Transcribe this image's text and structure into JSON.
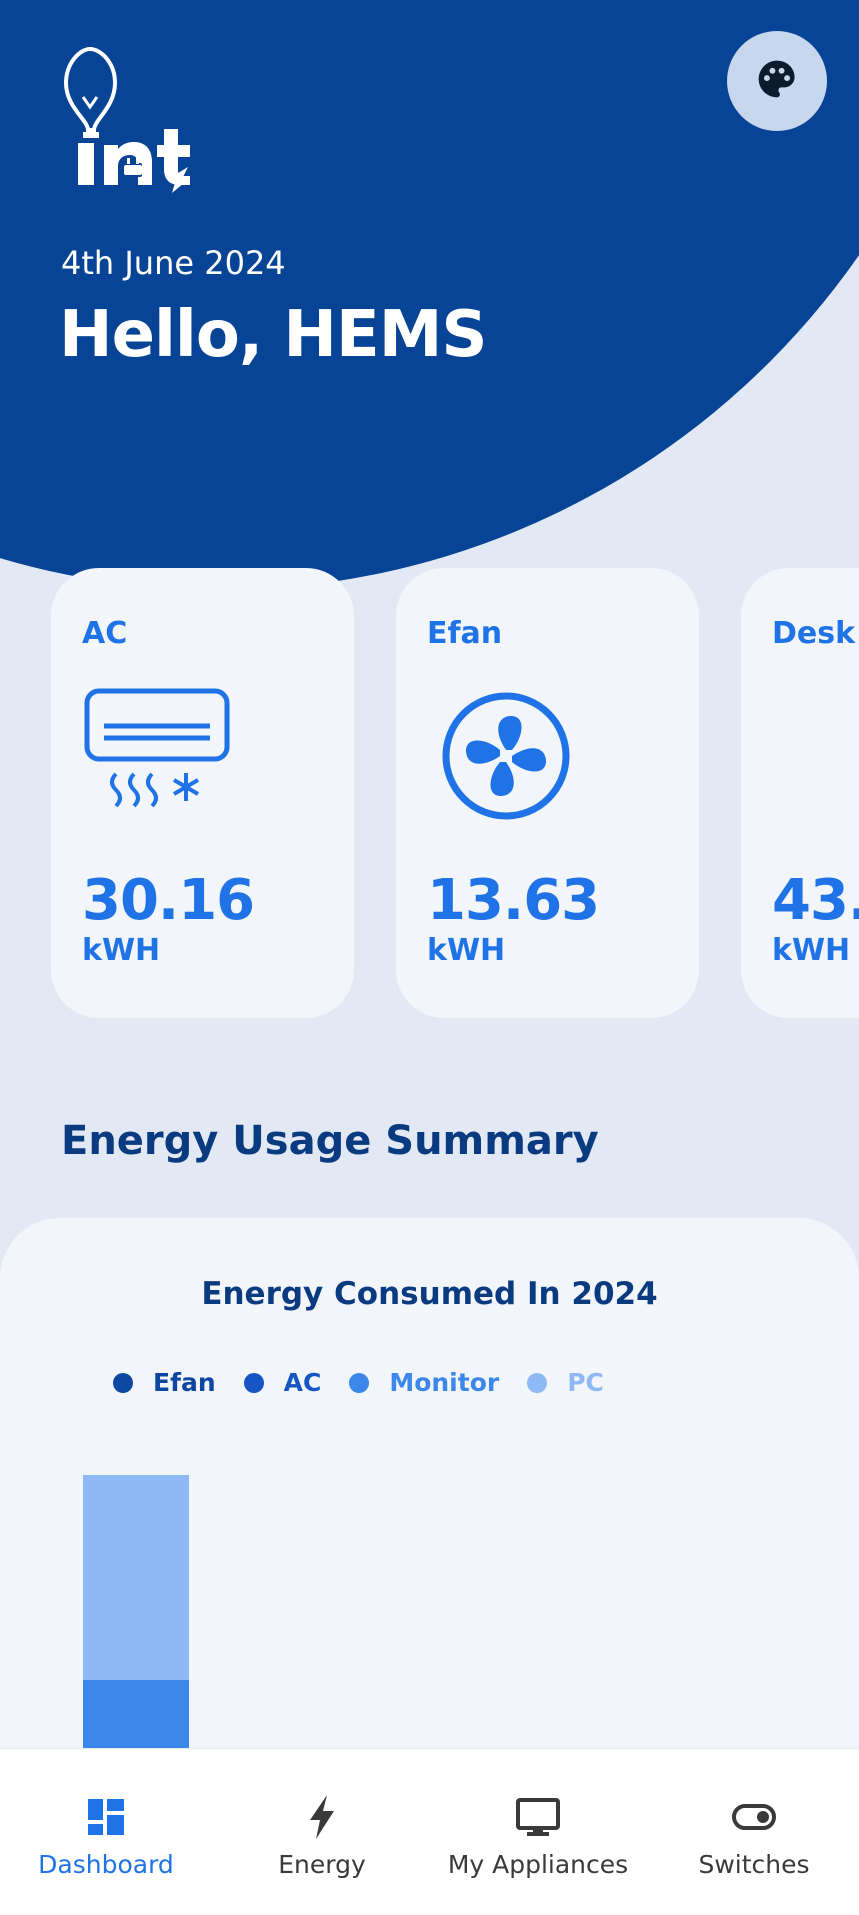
{
  "header": {
    "date": "4th June 2024",
    "greeting": "Hello, HEMS"
  },
  "icons": {
    "logo": "int-bulb-logo",
    "theme": "palette-icon"
  },
  "appliances": [
    {
      "name": "AC",
      "icon": "air-conditioner-icon",
      "value": "30.16",
      "unit": "kWH"
    },
    {
      "name": "Efan",
      "icon": "fan-icon",
      "value": "13.63",
      "unit": "kWH"
    },
    {
      "name": "Desk",
      "icon": "",
      "value": "43.",
      "unit": "kWH"
    }
  ],
  "section_title": "Energy Usage Summary",
  "chart_data": {
    "type": "bar",
    "title": "Energy Consumed In 2024",
    "stacked": true,
    "legend": "top",
    "series": [
      {
        "name": "Efan",
        "color": "#0d47a1",
        "values": [
          0
        ]
      },
      {
        "name": "AC",
        "color": "#1556c4",
        "values": [
          0
        ]
      },
      {
        "name": "Monitor",
        "color": "#3b87ea",
        "values": [
          68
        ]
      },
      {
        "name": "PC",
        "color": "#8fb9f4",
        "values": [
          205
        ]
      }
    ],
    "categories": [
      ""
    ],
    "grid": false
  },
  "nav": {
    "items": [
      {
        "label": "Dashboard",
        "icon": "dashboard-icon",
        "active": true
      },
      {
        "label": "Energy",
        "icon": "lightning-icon",
        "active": false
      },
      {
        "label": "My Appliances",
        "icon": "monitor-icon",
        "active": false
      },
      {
        "label": "Switches",
        "icon": "toggle-icon",
        "active": false
      }
    ]
  },
  "colors": {
    "primary_dark": "#084496",
    "accent": "#1f73e6",
    "background": "#e3e9f4",
    "card": "#f2f5f9"
  }
}
